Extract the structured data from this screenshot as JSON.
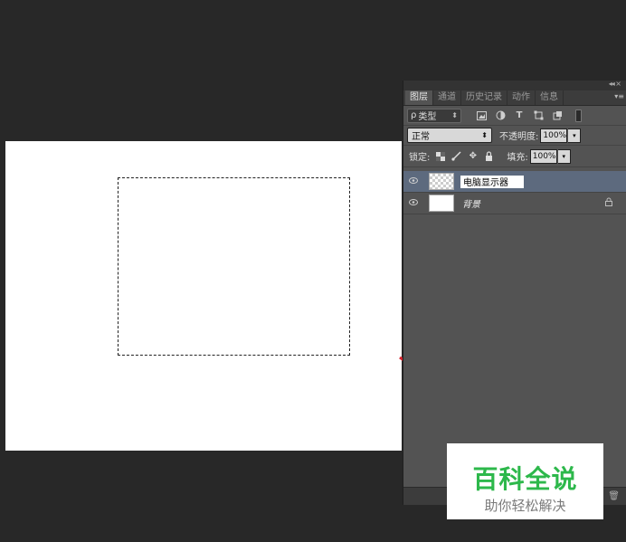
{
  "canvas": {
    "background": "#ffffff"
  },
  "layers_panel": {
    "tabs": [
      {
        "label": "图层",
        "active": true
      },
      {
        "label": "通道",
        "active": false
      },
      {
        "label": "历史记录",
        "active": false
      },
      {
        "label": "动作",
        "active": false
      },
      {
        "label": "信息",
        "active": false
      }
    ],
    "filter": {
      "label": "类型",
      "search_icon": "ρ"
    },
    "blend_mode": "正常",
    "opacity_label": "不透明度:",
    "opacity_value": "100%",
    "lock_label": "锁定:",
    "fill_label": "填充:",
    "fill_value": "100%",
    "layers": [
      {
        "name": "电脑显示器",
        "editing": true,
        "selected": true,
        "thumbnail": "transparent"
      },
      {
        "name": "背景",
        "editing": false,
        "selected": false,
        "thumbnail": "white",
        "locked": true
      }
    ]
  },
  "annotation": {
    "color": "#d4202a"
  },
  "watermark": {
    "title": "百科全说",
    "subtitle": "助你轻松解决",
    "title_color": "#2db84b"
  }
}
